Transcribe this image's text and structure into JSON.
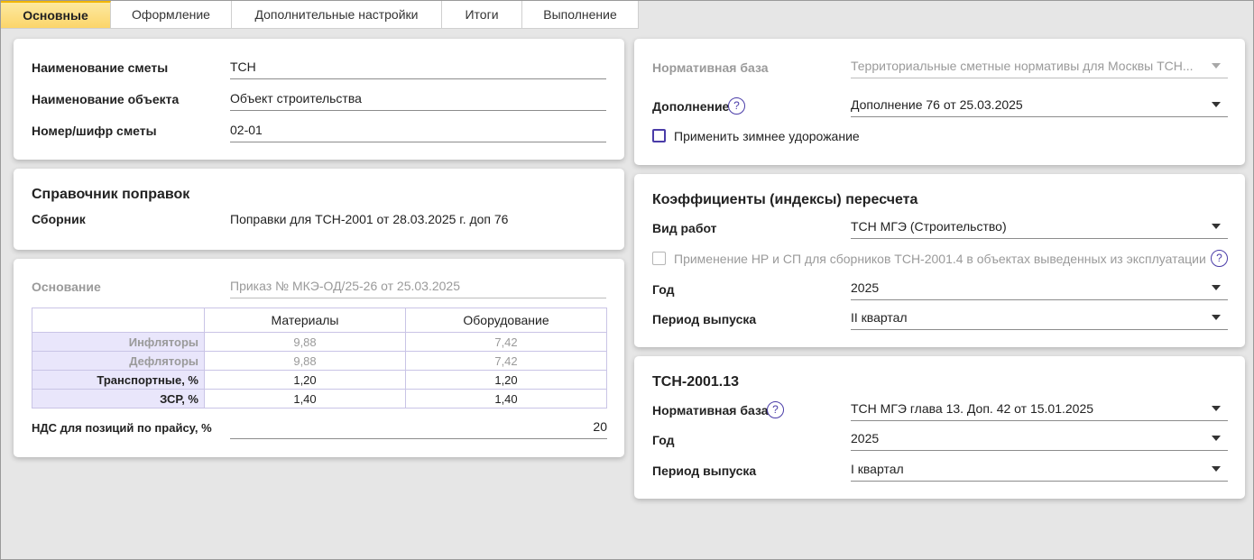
{
  "tabs": [
    "Основные",
    "Оформление",
    "Дополнительные настройки",
    "Итоги",
    "Выполнение"
  ],
  "main_info": {
    "estimate_name_label": "Наименование сметы",
    "estimate_name_value": "ТСН",
    "object_name_label": "Наименование объекта",
    "object_name_value": "Объект строительства",
    "estimate_code_label": "Номер/шифр сметы",
    "estimate_code_value": "02-01"
  },
  "corrections": {
    "title": "Справочник поправок",
    "collection_label": "Сборник",
    "collection_value": "Поправки для ТСН-2001 от 28.03.2025 г. доп 76"
  },
  "basis": {
    "basis_label": "Основание",
    "basis_value": "Приказ № МКЭ-ОД/25-26 от 25.03.2025",
    "table": {
      "columns": [
        "Материалы",
        "Оборудование"
      ],
      "rows": [
        {
          "label": "Инфляторы",
          "materials": "9,88",
          "equipment": "7,42",
          "disabled": true
        },
        {
          "label": "Дефляторы",
          "materials": "9,88",
          "equipment": "7,42",
          "disabled": true
        },
        {
          "label": "Транспортные, %",
          "materials": "1,20",
          "equipment": "1,20",
          "disabled": false
        },
        {
          "label": "ЗСР, %",
          "materials": "1,40",
          "equipment": "1,40",
          "disabled": false
        }
      ]
    },
    "vat_label": "НДС для позиций по прайсу, %",
    "vat_value": "20"
  },
  "normative": {
    "base_label": "Нормативная база",
    "base_value": "Территориальные сметные нормативы для Москвы ТСН...",
    "addition_label": "Дополнение",
    "addition_value": "Дополнение 76 от 25.03.2025",
    "winter_label": "Применить зимнее удорожание"
  },
  "recalc": {
    "title": "Коэффициенты (индексы) пересчета",
    "work_type_label": "Вид работ",
    "work_type_value": "ТСН МГЭ (Строительство)",
    "hp_sp_label": "Применение НР и СП для сборников ТСН-2001.4 в объектах выведенных из эксплуатации",
    "year_label": "Год",
    "year_value": "2025",
    "period_label": "Период выпуска",
    "period_value": "II квартал"
  },
  "tsn13": {
    "title": "ТСН-2001.13",
    "base_label": "Нормативная база",
    "base_value": "ТСН МГЭ глава 13. Доп. 42 от 15.01.2025",
    "year_label": "Год",
    "year_value": "2025",
    "period_label": "Период выпуска",
    "period_value": "I квартал"
  },
  "icons": {
    "help": "?"
  },
  "colors": {
    "accent": "#4a3ca8",
    "tab_active": "#fbd56a",
    "table_header_bg": "#e9e6fb"
  }
}
